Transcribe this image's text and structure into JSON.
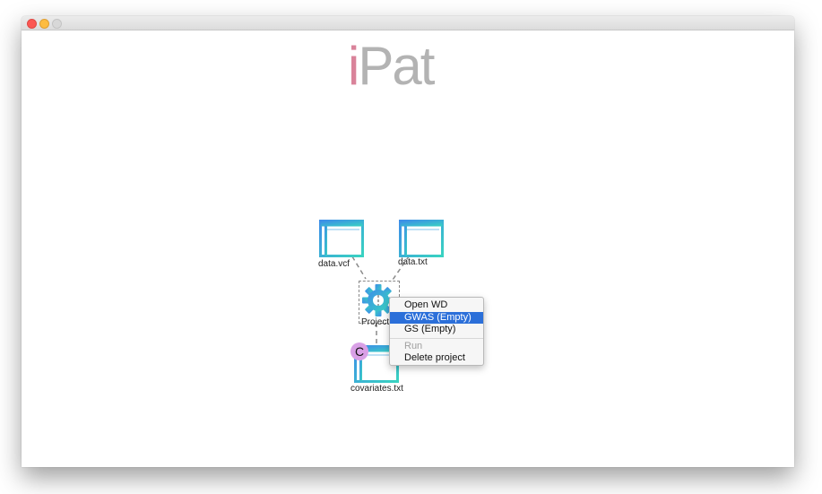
{
  "app": {
    "logo_i": "i",
    "logo_rest": "Pat"
  },
  "nodes": {
    "vcf": {
      "label": "data.vcf",
      "icon": "table-file-icon"
    },
    "txt": {
      "label": "data.txt",
      "icon": "table-file-icon"
    },
    "project": {
      "label": "Project",
      "icon": "gear-icon"
    },
    "covariates": {
      "label": "covariates.txt",
      "icon": "table-file-icon",
      "badge": "C"
    }
  },
  "context_menu": {
    "items": [
      {
        "label": "Open WD",
        "state": "normal"
      },
      {
        "label": "GWAS (Empty)",
        "state": "selected"
      },
      {
        "label": "GS (Empty)",
        "state": "normal"
      },
      {
        "label": "Run",
        "state": "disabled"
      },
      {
        "label": "Delete project",
        "state": "normal"
      }
    ]
  },
  "colors": {
    "logo_i": "#d9839a",
    "logo_text": "#b3b3b3",
    "icon_blue": "#3d8ee8",
    "icon_teal": "#39d3c1",
    "badge": "#d9a0e6",
    "menu_selected": "#2b6fd9"
  }
}
